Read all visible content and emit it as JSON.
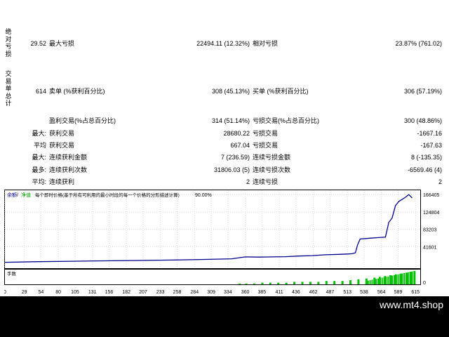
{
  "side_labels": {
    "absolute_loss": "绝对亏损",
    "trade_summary": "交易单总计"
  },
  "stats": {
    "row1": {
      "v1": "29.52",
      "l2": "最大亏损",
      "v2": "22494.11 (12.32%)",
      "l3": "相对亏损",
      "v3": "23.87% (761.02)"
    },
    "row2": {
      "v1": "614",
      "l2": "卖单 (%获利百分比)",
      "v2": "308 (45.13%)",
      "l3": "买单 (%获利百分比)",
      "v3": "306 (57.19%)"
    },
    "row3": {
      "l2": "盈利交易(%占总百分比)",
      "v2": "314 (51.14%)",
      "l3": "亏损交易(%占总百分比)",
      "v3": "300 (48.86%)"
    },
    "row4": {
      "l1": "最大:",
      "l2": "获利交易",
      "v2": "28680.22",
      "l3": "亏损交易",
      "v3": "-1667.16"
    },
    "row5": {
      "l1": "平均",
      "l2": "获利交易",
      "v2": "667.04",
      "l3": "亏损交易",
      "v3": "-167.63"
    },
    "row6": {
      "l1": "最大:",
      "l2": "连续获利金额",
      "v2": "7 (236.59)",
      "l3": "连续亏损金额",
      "v3": "8 (-135.35)"
    },
    "row7": {
      "l1": "最多:",
      "l2": "连续获利次数",
      "v2": "31806.03 (5)",
      "l3": "连续亏损次数",
      "v3": "-6569.46 (4)"
    },
    "row8": {
      "l1": "平均:",
      "l2": "连续获利",
      "v2": "2",
      "l3": "连续亏损",
      "v3": "2"
    }
  },
  "chart_header": {
    "balance_label": "余额",
    "separator": "/",
    "equity_label": "净值",
    "description": "每个即时价格(基于所有可利用的最小时段的每一个价格的分形描述计算)",
    "quality": "90.00%"
  },
  "volume_label": "手数",
  "footer": {
    "brand": "www.mt4.shop"
  },
  "colors": {
    "balance": "#00008b",
    "equity": "#00c000",
    "volume": "#00c000",
    "footer_bg": "#000000"
  },
  "chart_data": {
    "type": "line",
    "x": [
      0,
      29,
      54,
      80,
      105,
      131,
      156,
      182,
      207,
      233,
      258,
      284,
      309,
      334,
      360,
      385,
      411,
      436,
      462,
      487,
      513,
      538,
      564,
      589,
      615
    ],
    "xticks": [
      "0",
      "29",
      "54",
      "80",
      "105",
      "131",
      "156",
      "182",
      "207",
      "233",
      "258",
      "284",
      "309",
      "334",
      "360",
      "385",
      "411",
      "436",
      "462",
      "487",
      "513",
      "538",
      "564",
      "589",
      "615"
    ],
    "yticks": [
      "166405",
      "124804",
      "83203",
      "41601",
      "0"
    ],
    "ylim": [
      0,
      170000
    ],
    "xlim": [
      0,
      620
    ],
    "series": [
      {
        "values": [
          [
            0,
            4000
          ],
          [
            50,
            5500
          ],
          [
            100,
            6500
          ],
          [
            150,
            7500
          ],
          [
            200,
            8500
          ],
          [
            250,
            9500
          ],
          [
            300,
            11000
          ],
          [
            340,
            12500
          ],
          [
            360,
            17000
          ],
          [
            380,
            16500
          ],
          [
            400,
            17000
          ],
          [
            420,
            17500
          ],
          [
            440,
            19000
          ],
          [
            460,
            20000
          ],
          [
            480,
            22000
          ],
          [
            500,
            23000
          ],
          [
            515,
            24000
          ],
          [
            520,
            24500
          ],
          [
            525,
            27000
          ],
          [
            528,
            45000
          ],
          [
            532,
            60000
          ],
          [
            540,
            61000
          ],
          [
            548,
            62000
          ],
          [
            556,
            63000
          ],
          [
            565,
            64000
          ],
          [
            570,
            64500
          ],
          [
            575,
            100000
          ],
          [
            580,
            110000
          ],
          [
            585,
            140000
          ],
          [
            590,
            150000
          ],
          [
            595,
            155000
          ],
          [
            600,
            160000
          ],
          [
            605,
            166405
          ],
          [
            610,
            158000
          ]
        ]
      }
    ],
    "volume": [
      [
        350,
        1
      ],
      [
        360,
        1
      ],
      [
        372,
        1
      ],
      [
        384,
        2
      ],
      [
        396,
        2
      ],
      [
        408,
        2
      ],
      [
        420,
        2
      ],
      [
        432,
        3
      ],
      [
        444,
        3
      ],
      [
        456,
        3
      ],
      [
        468,
        3
      ],
      [
        480,
        4
      ],
      [
        492,
        4
      ],
      [
        504,
        4
      ],
      [
        516,
        5
      ],
      [
        528,
        6
      ],
      [
        540,
        7
      ],
      [
        552,
        8
      ],
      [
        560,
        9
      ],
      [
        568,
        10
      ],
      [
        576,
        11
      ],
      [
        584,
        12
      ],
      [
        592,
        13
      ],
      [
        600,
        14
      ],
      [
        606,
        15
      ],
      [
        612,
        16
      ]
    ]
  }
}
